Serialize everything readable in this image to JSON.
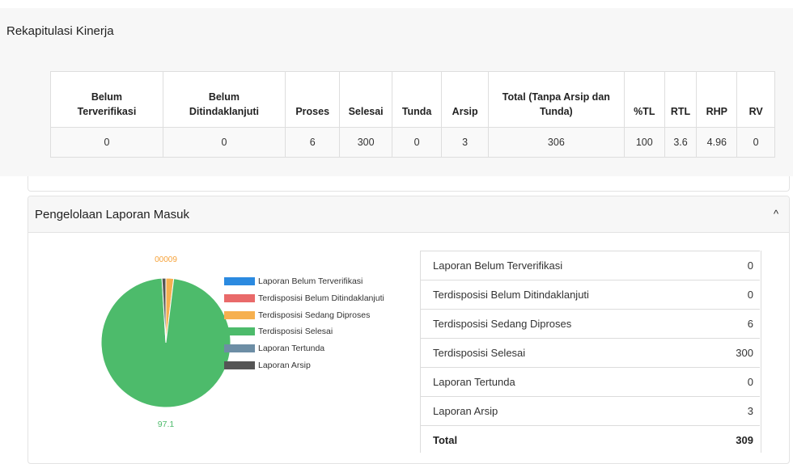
{
  "rekap": {
    "title": "Rekapitulasi Kinerja",
    "headers": [
      [
        "Belum",
        "Terverifikasi"
      ],
      [
        "Belum",
        "Ditindaklanjuti"
      ],
      [
        "Proses"
      ],
      [
        "Selesai"
      ],
      [
        "Tunda"
      ],
      [
        "Arsip"
      ],
      [
        "Total (Tanpa Arsip dan",
        "Tunda)"
      ],
      [
        "%TL"
      ],
      [
        "RTL"
      ],
      [
        "RHP"
      ],
      [
        "RV"
      ]
    ],
    "values": [
      "0",
      "0",
      "6",
      "300",
      "0",
      "3",
      "306",
      "100",
      "3.6",
      "4.96",
      "0"
    ]
  },
  "laporan": {
    "title": "Pengelolaan Laporan Masuk",
    "collapse_icon": "chevron-up-icon",
    "collapse_glyph": "^",
    "chart_top_label": "00009",
    "chart_bottom_label": "97.1",
    "rows": [
      {
        "label": "Laporan Belum Terverifikasi",
        "value": "0"
      },
      {
        "label": "Terdisposisi Belum Ditindaklanjuti",
        "value": "0"
      },
      {
        "label": "Terdisposisi Sedang Diproses",
        "value": "6"
      },
      {
        "label": "Terdisposisi Selesai",
        "value": "300"
      },
      {
        "label": "Laporan Tertunda",
        "value": "0"
      },
      {
        "label": "Laporan Arsip",
        "value": "3"
      }
    ],
    "total": {
      "label": "Total",
      "value": "309"
    }
  },
  "chart_data": {
    "type": "pie",
    "categories": [
      "Laporan Belum Terverifikasi",
      "Terdisposisi Belum Ditindaklanjuti",
      "Terdisposisi Sedang Diproses",
      "Terdisposisi Selesai",
      "Laporan Tertunda",
      "Laporan Arsip"
    ],
    "values": [
      0,
      0,
      6,
      300,
      0,
      3
    ],
    "colors": [
      "#2b8ae0",
      "#e96a6a",
      "#f6b04f",
      "#4dbb6b",
      "#6d8ea5",
      "#555555"
    ],
    "legend_position": "right"
  }
}
